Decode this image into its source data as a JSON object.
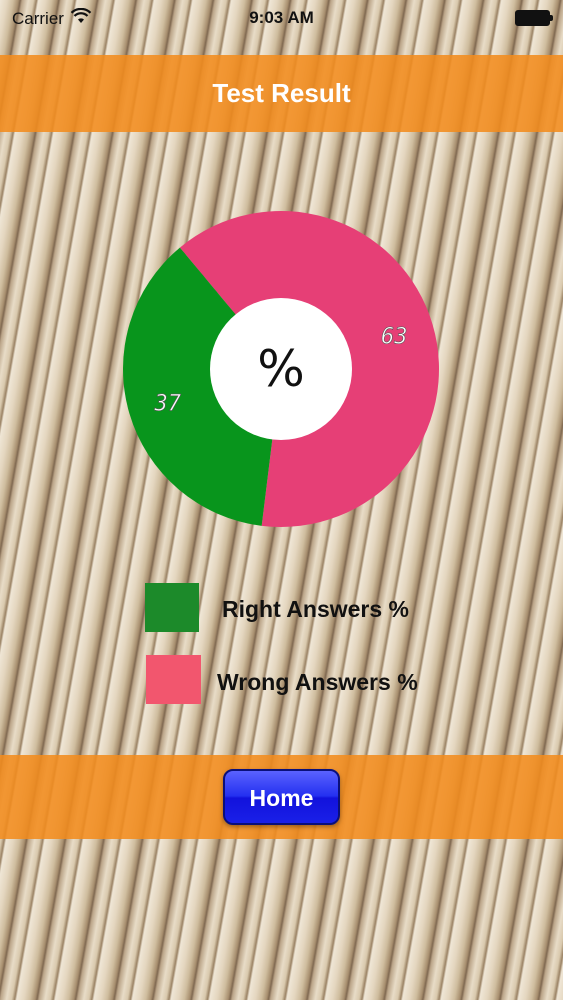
{
  "status_bar": {
    "carrier": "Carrier",
    "time": "9:03 AM",
    "wifi_icon": "wifi-icon",
    "battery_icon": "battery-icon"
  },
  "header": {
    "title": "Test Result"
  },
  "chart_data": {
    "type": "pie",
    "center_label": "%",
    "slices": [
      {
        "label": "Wrong Answers %",
        "value": 63,
        "color": "#e63f76"
      },
      {
        "label": "Right Answers %",
        "value": 37,
        "color": "#08951c"
      }
    ]
  },
  "legend": {
    "items": [
      {
        "label": "Right Answers %",
        "color": "#1c8a2a"
      },
      {
        "label": "Wrong Answers %",
        "color": "#f2566e"
      }
    ]
  },
  "footer": {
    "home_label": "Home"
  }
}
